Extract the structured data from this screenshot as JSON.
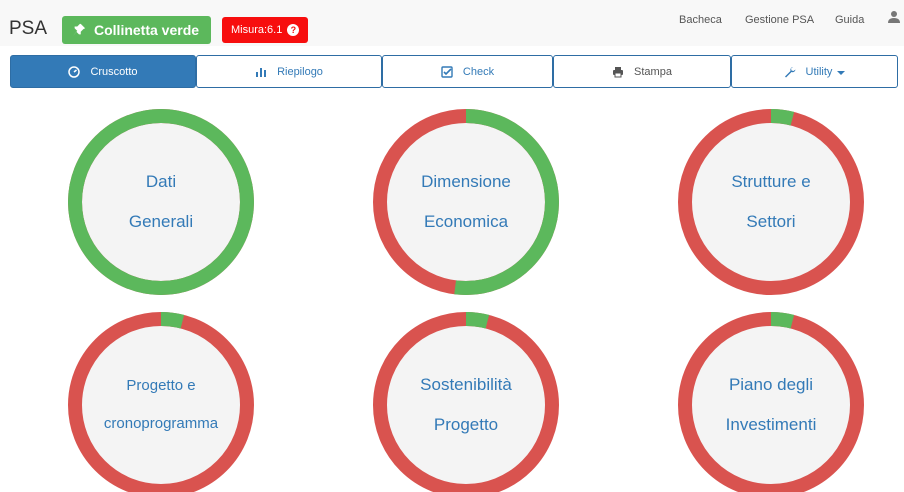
{
  "header": {
    "brand": "PSA",
    "project_name": "Collinetta verde",
    "measure_label": "Misura:6.1",
    "help_glyph": "?",
    "links": [
      "Bacheca",
      "Gestione PSA",
      "Guida"
    ],
    "project_icon": "pushpin-icon",
    "user_icon": "user-icon"
  },
  "tabs": [
    {
      "label": "Cruscotto",
      "icon": "dashboard-icon",
      "active": true
    },
    {
      "label": "Riepilogo",
      "icon": "bar-chart-icon",
      "active": false
    },
    {
      "label": "Check",
      "icon": "check-icon",
      "active": false
    },
    {
      "label": "Stampa",
      "icon": "print-icon",
      "active": false
    },
    {
      "label": "Utility",
      "icon": "wrench-icon",
      "active": false,
      "dropdown": true
    }
  ],
  "tiles": [
    {
      "lines": [
        "Dati",
        "Generali"
      ],
      "progress": 1.0
    },
    {
      "lines": [
        "Dimensione",
        "Economica"
      ],
      "progress": 0.52
    },
    {
      "lines": [
        "Strutture e",
        "Settori"
      ],
      "progress": 0.04
    },
    {
      "lines": [
        "Progetto e",
        "cronoprogramma"
      ],
      "progress": 0.04
    },
    {
      "lines": [
        "Sostenibilità",
        "Progetto"
      ],
      "progress": 0.04
    },
    {
      "lines": [
        "Piano degli",
        "Investimenti"
      ],
      "progress": 0.04
    }
  ],
  "colors": {
    "complete": "#5cb85c",
    "incomplete": "#d9534f",
    "primary": "#337ab7",
    "alert": "#f70e0e",
    "inner": "#f4f4f4"
  }
}
